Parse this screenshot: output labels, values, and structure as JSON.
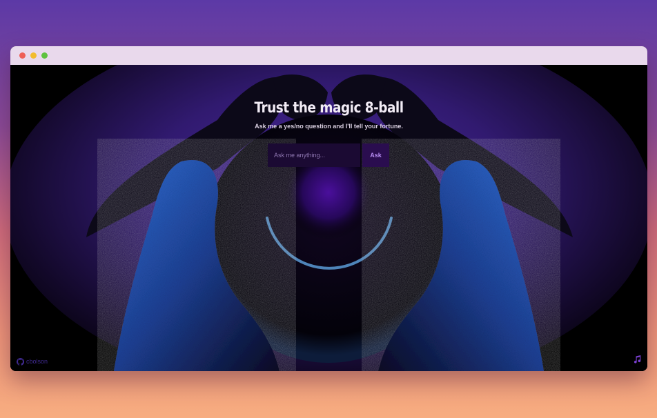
{
  "window": {
    "controls": [
      "close",
      "minimize",
      "maximize"
    ]
  },
  "app": {
    "title": "Trust the magic 8-ball",
    "subtitle": "Ask me a yes/no question and I'll tell your fortune.",
    "input_placeholder": "Ask me anything...",
    "ask_label": "Ask"
  },
  "footer": {
    "github_label": "cbolson",
    "github_icon": "github-icon",
    "music_icon": "music-note-icon"
  },
  "colors": {
    "accent": "#b58bf0",
    "input_bg": "#1b0a33",
    "button_bg": "#2a0d4f",
    "hands": "#2b65c4"
  }
}
